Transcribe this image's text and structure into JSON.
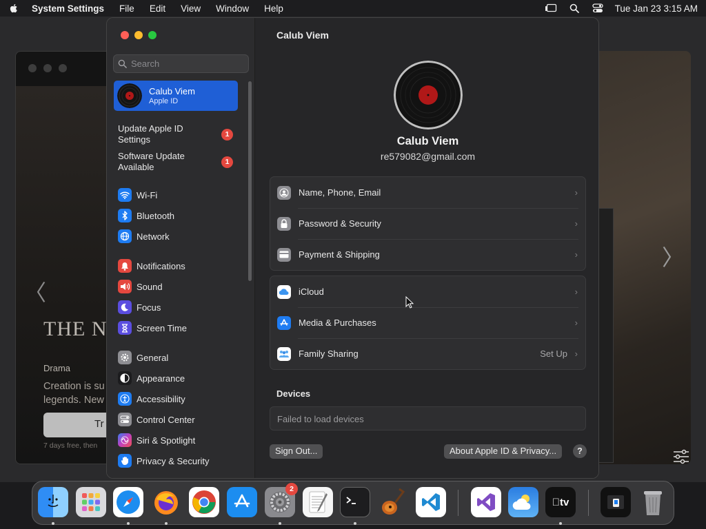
{
  "menubar": {
    "app_name": "System Settings",
    "menus": [
      "File",
      "Edit",
      "View",
      "Window",
      "Help"
    ],
    "clock": "Tue Jan 23  3:15 AM"
  },
  "background_app": {
    "title_fragment": "THE N",
    "genre": "Drama",
    "desc_line1": "Creation is su",
    "desc_line2": "legends. New",
    "try_button": "Tr",
    "fine_print": "7 days free, then"
  },
  "sidebar": {
    "search_placeholder": "Search",
    "profile": {
      "name": "Calub Viem",
      "subtitle": "Apple ID"
    },
    "notices": [
      {
        "label": "Update Apple ID Settings",
        "badge": "1"
      },
      {
        "label": "Software Update Available",
        "badge": "1"
      }
    ],
    "items": [
      {
        "label": "Wi-Fi",
        "icon": "wifi-icon",
        "color": "#1e7cf2"
      },
      {
        "label": "Bluetooth",
        "icon": "bluetooth-icon",
        "color": "#1e7cf2"
      },
      {
        "label": "Network",
        "icon": "globe-icon",
        "color": "#1e7cf2"
      },
      {
        "label": "Notifications",
        "icon": "bell-icon",
        "color": "#e5483f"
      },
      {
        "label": "Sound",
        "icon": "speaker-icon",
        "color": "#e5483f"
      },
      {
        "label": "Focus",
        "icon": "moon-icon",
        "color": "#5b4ee0"
      },
      {
        "label": "Screen Time",
        "icon": "hourglass-icon",
        "color": "#5b4ee0"
      },
      {
        "label": "General",
        "icon": "gear-icon",
        "color": "#8e8e93"
      },
      {
        "label": "Appearance",
        "icon": "appearance-icon",
        "color": "#1c1c1e"
      },
      {
        "label": "Accessibility",
        "icon": "accessibility-icon",
        "color": "#1e7cf2"
      },
      {
        "label": "Control Center",
        "icon": "toggles-icon",
        "color": "#8e8e93"
      },
      {
        "label": "Siri & Spotlight",
        "icon": "siri-icon",
        "color": "#b040d0"
      },
      {
        "label": "Privacy & Security",
        "icon": "hand-icon",
        "color": "#1e7cf2"
      }
    ]
  },
  "main": {
    "title": "Calub Viem",
    "user_name": "Calub Viem",
    "email": "re579082@gmail.com",
    "group1": [
      {
        "label": "Name, Phone, Email",
        "icon": "person-icon",
        "color": "#8e8e93"
      },
      {
        "label": "Password & Security",
        "icon": "lock-icon",
        "color": "#8e8e93"
      },
      {
        "label": "Payment & Shipping",
        "icon": "card-icon",
        "color": "#8e8e93"
      }
    ],
    "group2": [
      {
        "label": "iCloud",
        "icon": "cloud-icon",
        "color": "#ffffff",
        "value": ""
      },
      {
        "label": "Media & Purchases",
        "icon": "appstore-icon",
        "color": "#1e7cf2",
        "value": ""
      },
      {
        "label": "Family Sharing",
        "icon": "family-icon",
        "color": "#ffffff",
        "value": "Set Up"
      }
    ],
    "devices_heading": "Devices",
    "devices_message": "Failed to load devices",
    "sign_out": "Sign Out...",
    "about": "About Apple ID & Privacy...",
    "help": "?"
  },
  "dock": {
    "apps": [
      {
        "name": "Finder",
        "icon": "finder-icon"
      },
      {
        "name": "Launchpad",
        "icon": "launchpad-icon"
      },
      {
        "name": "Safari",
        "icon": "safari-icon"
      },
      {
        "name": "Firefox",
        "icon": "firefox-icon"
      },
      {
        "name": "Chrome",
        "icon": "chrome-icon"
      },
      {
        "name": "App Store",
        "icon": "appstore-icon"
      },
      {
        "name": "System Settings",
        "icon": "settings-icon",
        "badge": "2"
      },
      {
        "name": "TextEdit",
        "icon": "textedit-icon"
      },
      {
        "name": "Terminal",
        "icon": "terminal-icon"
      },
      {
        "name": "GarageBand",
        "icon": "guitar-icon"
      },
      {
        "name": "VS Code",
        "icon": "vscode-icon"
      },
      {
        "name": "Visual Studio",
        "icon": "visualstudio-icon"
      },
      {
        "name": "Weather",
        "icon": "weather-icon"
      },
      {
        "name": "TV",
        "icon": "tv-icon",
        "label": "tv"
      },
      {
        "name": "Preview",
        "icon": "preview-icon"
      },
      {
        "name": "Trash",
        "icon": "trash-icon"
      }
    ]
  },
  "colors": {
    "accent": "#1f5fd6",
    "badge": "#e5483f",
    "close": "#ff5f57",
    "minimize": "#febc2e",
    "zoom": "#28c840"
  }
}
